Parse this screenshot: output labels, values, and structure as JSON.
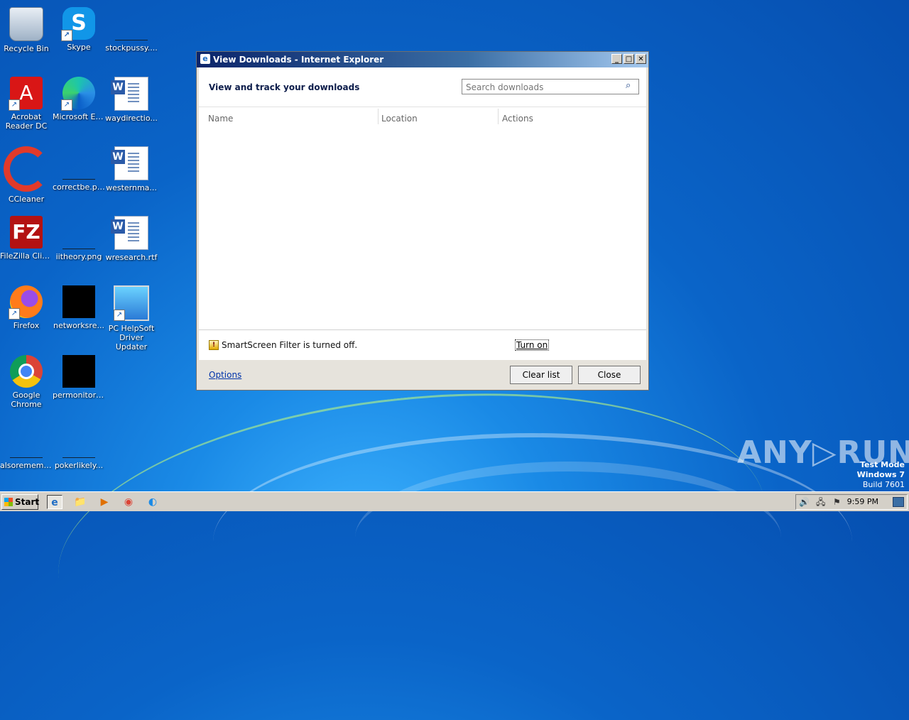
{
  "desktop": {
    "icons": [
      {
        "label": "Recycle Bin"
      },
      {
        "label": "Skype"
      },
      {
        "label": "stockpussy...."
      },
      {
        "label": "Acrobat Reader DC"
      },
      {
        "label": "Microsoft Edge"
      },
      {
        "label": "waydirectio..."
      },
      {
        "label": "CCleaner"
      },
      {
        "label": "correctbe.png"
      },
      {
        "label": "westernma..."
      },
      {
        "label": "FileZilla Client"
      },
      {
        "label": "iitheory.png"
      },
      {
        "label": "wresearch.rtf"
      },
      {
        "label": "Firefox"
      },
      {
        "label": "networksre..."
      },
      {
        "label": "PC HelpSoft Driver Updater"
      },
      {
        "label": "Google Chrome"
      },
      {
        "label": "permonitori..."
      },
      {
        "label": "alsorememb..."
      },
      {
        "label": "pokerlikely..."
      }
    ],
    "icon_glyphs": {
      "skype": "S",
      "acrobat": "A",
      "word": "W",
      "filezilla": "FZ"
    }
  },
  "window": {
    "title": "View Downloads - Internet Explorer",
    "title_buttons": {
      "minimize": "_",
      "maximize": "□",
      "close": "✕"
    },
    "heading": "View and track your downloads",
    "search": {
      "placeholder": "Search downloads",
      "icon": "search-icon",
      "glyph": "⌕"
    },
    "columns": [
      "Name",
      "Location",
      "Actions"
    ],
    "smartscreen": {
      "text": "SmartScreen Filter is turned off.",
      "link": "Turn on",
      "icon": "shield-warning-icon"
    },
    "footer": {
      "options": "Options",
      "clear_list": "Clear list",
      "close": "Close"
    }
  },
  "taskbar": {
    "start_label": "Start",
    "pinned": [
      {
        "name": "internet-explorer",
        "glyph": "e"
      },
      {
        "name": "file-explorer",
        "glyph": "📁"
      },
      {
        "name": "media-player",
        "glyph": "▶"
      },
      {
        "name": "chrome",
        "glyph": "◉"
      },
      {
        "name": "edge",
        "glyph": "◐"
      }
    ],
    "tray_glyphs": {
      "speaker": "🔊",
      "network": "🖧",
      "flag": "⚑"
    },
    "clock": "9:59 PM"
  },
  "watermark": "ANY▷RUN",
  "os_info": {
    "line1": "Test Mode",
    "line2": "Windows 7",
    "line3": "Build 7601"
  }
}
